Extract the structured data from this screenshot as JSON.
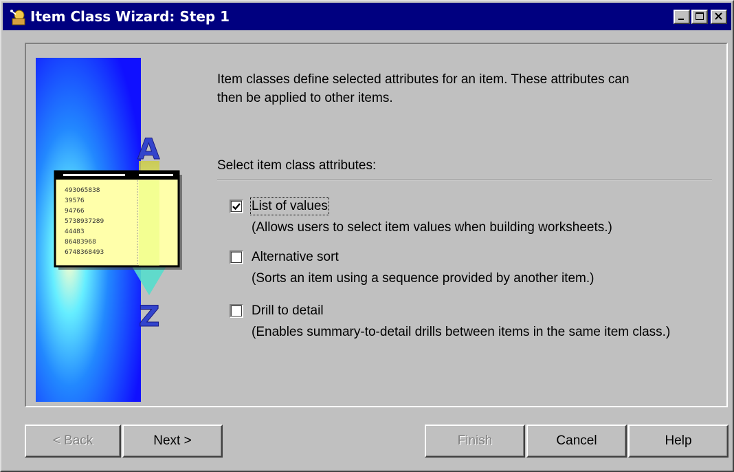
{
  "window": {
    "title": "Item Class Wizard: Step 1",
    "icon": "wizard-icon",
    "controls": [
      "minimize-icon",
      "maximize-icon",
      "close-icon"
    ]
  },
  "illustration": {
    "top_letter": "A",
    "bottom_letter": "Z",
    "list_values": [
      "493065838",
      "39576",
      "94766",
      "5738937289",
      "44483",
      "86483968",
      "6748368493"
    ]
  },
  "content": {
    "description_line1": "Item classes define selected attributes for an item.  These attributes can",
    "description_line2": "then be applied to other items.",
    "section_label": "Select item class attributes:",
    "options": [
      {
        "label": "List of values",
        "description": "(Allows users to select item values when building worksheets.)",
        "checked": true
      },
      {
        "label": "Alternative sort",
        "description": "(Sorts an item using a sequence provided by another item.)",
        "checked": false
      },
      {
        "label": "Drill to detail",
        "description": "(Enables summary-to-detail drills between items in the same item class.)",
        "checked": false
      }
    ]
  },
  "buttons": {
    "back": "< Back",
    "next": "Next >",
    "finish": "Finish",
    "cancel": "Cancel",
    "help": "Help"
  },
  "colors": {
    "title_bar": "#000080",
    "dialog_face": "#c0c0c0",
    "art_blue": "#1010ff",
    "art_glow": "#22ccff"
  }
}
